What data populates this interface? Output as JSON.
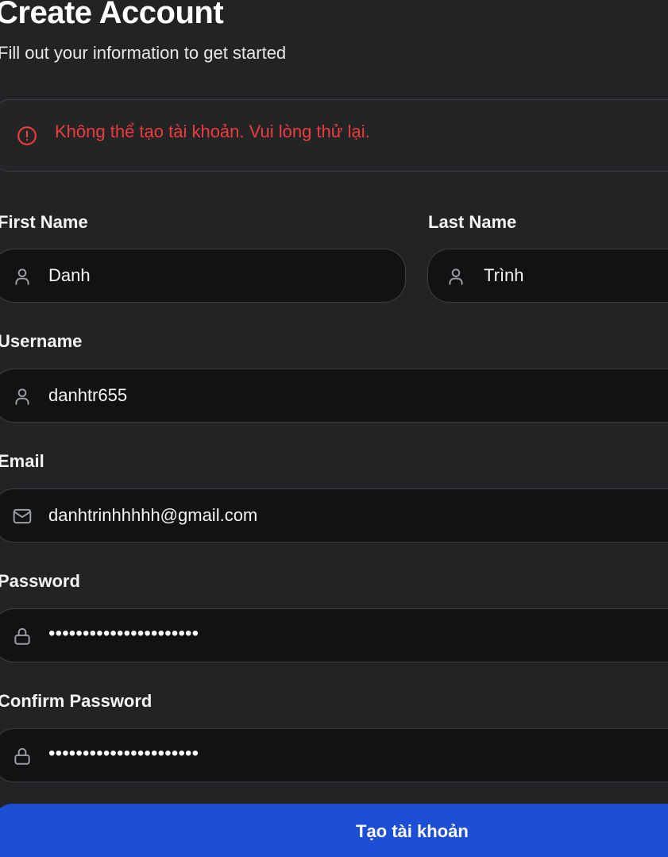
{
  "header": {
    "title": "Create Account",
    "subtitle": "Fill out your information to get started"
  },
  "error": {
    "message": "Không thể tạo tài khoản. Vui lòng thử lại.",
    "icon": "alert-circle-icon",
    "color": "#ef3b3b"
  },
  "form": {
    "first_name": {
      "label": "First Name",
      "value": "Danh",
      "icon": "user-icon"
    },
    "last_name": {
      "label": "Last Name",
      "value": "Trình",
      "icon": "user-icon"
    },
    "username": {
      "label": "Username",
      "value": "danhtr655",
      "icon": "user-icon"
    },
    "email": {
      "label": "Email",
      "value": "danhtrinhhhhh@gmail.com",
      "icon": "mail-icon"
    },
    "password": {
      "label": "Password",
      "value": "••••••••••••••••••••••",
      "icon": "lock-icon"
    },
    "confirm_password": {
      "label": "Confirm Password",
      "value": "••••••••••••••••••••••",
      "icon": "lock-icon"
    }
  },
  "submit": {
    "label": "Tạo tài khoản",
    "color": "#1c4fd6"
  }
}
